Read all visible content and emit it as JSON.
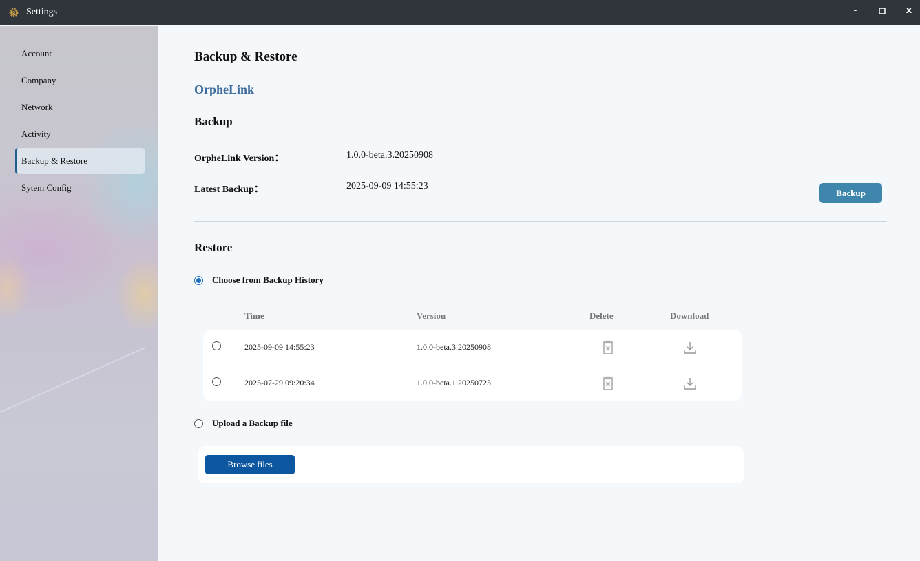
{
  "window": {
    "title": "Settings",
    "minimize_label": "-",
    "maximize_label": "☐",
    "close_label": "x"
  },
  "sidebar": {
    "items": [
      {
        "label": "Account"
      },
      {
        "label": "Company"
      },
      {
        "label": "Network"
      },
      {
        "label": "Activity"
      },
      {
        "label": "Backup & Restore",
        "active": true
      },
      {
        "label": "Sytem Config"
      }
    ]
  },
  "main": {
    "title": "Backup & Restore",
    "brand": "OrpheLink",
    "backup": {
      "heading": "Backup",
      "version_label": "OrpheLink Version：",
      "version_value": "1.0.0-beta.3.20250908",
      "latest_label": "Latest Backup：",
      "latest_value": "2025-09-09 14:55:23",
      "button_label": "Backup"
    },
    "restore": {
      "heading": "Restore",
      "option_history_label": "Choose from Backup History",
      "option_history_selected": true,
      "table": {
        "columns": [
          "Time",
          "Version",
          "Delete",
          "Download"
        ],
        "rows": [
          {
            "time": "2025-09-09 14:55:23",
            "version": "1.0.0-beta.3.20250908"
          },
          {
            "time": "2025-07-29 09:20:34",
            "version": "1.0.0-beta.1.20250725"
          }
        ]
      },
      "option_upload_label": "Upload a Backup file",
      "option_upload_selected": false,
      "browse_label": "Browse files"
    }
  },
  "colors": {
    "titlebar": "#2f353b",
    "brand": "#3e6c9c",
    "backup_button": "#3f86ad",
    "browse_button": "#0c57a0",
    "radio_selected": "#1a6fc0"
  }
}
